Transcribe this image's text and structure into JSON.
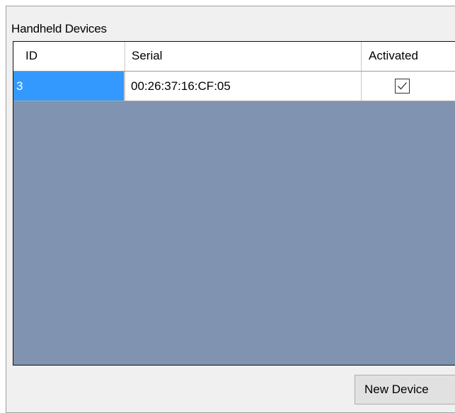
{
  "group": {
    "title": "Handheld Devices"
  },
  "grid": {
    "columns": [
      "ID",
      "Serial",
      "Activated"
    ],
    "rows": [
      {
        "id": "3",
        "serial": "00:26:37:16:CF:05",
        "activated": true
      }
    ]
  },
  "actions": {
    "new_device_label": "New Device"
  },
  "colors": {
    "grid_background": "#8093b0",
    "selection": "#3399ff",
    "window_background": "#f0f0f0"
  }
}
